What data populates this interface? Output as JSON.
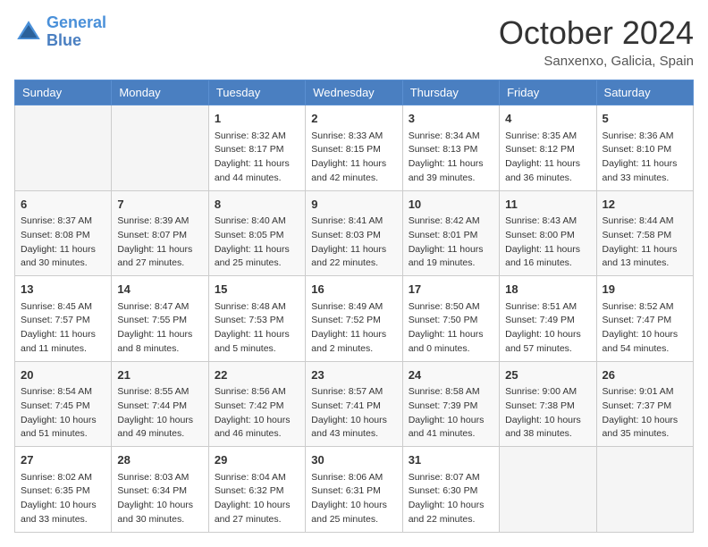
{
  "logo": {
    "line1": "General",
    "line2": "Blue"
  },
  "title": "October 2024",
  "location": "Sanxenxo, Galicia, Spain",
  "days_of_week": [
    "Sunday",
    "Monday",
    "Tuesday",
    "Wednesday",
    "Thursday",
    "Friday",
    "Saturday"
  ],
  "weeks": [
    [
      {
        "day": "",
        "content": ""
      },
      {
        "day": "",
        "content": ""
      },
      {
        "day": "1",
        "content": "Sunrise: 8:32 AM\nSunset: 8:17 PM\nDaylight: 11 hours and 44 minutes."
      },
      {
        "day": "2",
        "content": "Sunrise: 8:33 AM\nSunset: 8:15 PM\nDaylight: 11 hours and 42 minutes."
      },
      {
        "day": "3",
        "content": "Sunrise: 8:34 AM\nSunset: 8:13 PM\nDaylight: 11 hours and 39 minutes."
      },
      {
        "day": "4",
        "content": "Sunrise: 8:35 AM\nSunset: 8:12 PM\nDaylight: 11 hours and 36 minutes."
      },
      {
        "day": "5",
        "content": "Sunrise: 8:36 AM\nSunset: 8:10 PM\nDaylight: 11 hours and 33 minutes."
      }
    ],
    [
      {
        "day": "6",
        "content": "Sunrise: 8:37 AM\nSunset: 8:08 PM\nDaylight: 11 hours and 30 minutes."
      },
      {
        "day": "7",
        "content": "Sunrise: 8:39 AM\nSunset: 8:07 PM\nDaylight: 11 hours and 27 minutes."
      },
      {
        "day": "8",
        "content": "Sunrise: 8:40 AM\nSunset: 8:05 PM\nDaylight: 11 hours and 25 minutes."
      },
      {
        "day": "9",
        "content": "Sunrise: 8:41 AM\nSunset: 8:03 PM\nDaylight: 11 hours and 22 minutes."
      },
      {
        "day": "10",
        "content": "Sunrise: 8:42 AM\nSunset: 8:01 PM\nDaylight: 11 hours and 19 minutes."
      },
      {
        "day": "11",
        "content": "Sunrise: 8:43 AM\nSunset: 8:00 PM\nDaylight: 11 hours and 16 minutes."
      },
      {
        "day": "12",
        "content": "Sunrise: 8:44 AM\nSunset: 7:58 PM\nDaylight: 11 hours and 13 minutes."
      }
    ],
    [
      {
        "day": "13",
        "content": "Sunrise: 8:45 AM\nSunset: 7:57 PM\nDaylight: 11 hours and 11 minutes."
      },
      {
        "day": "14",
        "content": "Sunrise: 8:47 AM\nSunset: 7:55 PM\nDaylight: 11 hours and 8 minutes."
      },
      {
        "day": "15",
        "content": "Sunrise: 8:48 AM\nSunset: 7:53 PM\nDaylight: 11 hours and 5 minutes."
      },
      {
        "day": "16",
        "content": "Sunrise: 8:49 AM\nSunset: 7:52 PM\nDaylight: 11 hours and 2 minutes."
      },
      {
        "day": "17",
        "content": "Sunrise: 8:50 AM\nSunset: 7:50 PM\nDaylight: 11 hours and 0 minutes."
      },
      {
        "day": "18",
        "content": "Sunrise: 8:51 AM\nSunset: 7:49 PM\nDaylight: 10 hours and 57 minutes."
      },
      {
        "day": "19",
        "content": "Sunrise: 8:52 AM\nSunset: 7:47 PM\nDaylight: 10 hours and 54 minutes."
      }
    ],
    [
      {
        "day": "20",
        "content": "Sunrise: 8:54 AM\nSunset: 7:45 PM\nDaylight: 10 hours and 51 minutes."
      },
      {
        "day": "21",
        "content": "Sunrise: 8:55 AM\nSunset: 7:44 PM\nDaylight: 10 hours and 49 minutes."
      },
      {
        "day": "22",
        "content": "Sunrise: 8:56 AM\nSunset: 7:42 PM\nDaylight: 10 hours and 46 minutes."
      },
      {
        "day": "23",
        "content": "Sunrise: 8:57 AM\nSunset: 7:41 PM\nDaylight: 10 hours and 43 minutes."
      },
      {
        "day": "24",
        "content": "Sunrise: 8:58 AM\nSunset: 7:39 PM\nDaylight: 10 hours and 41 minutes."
      },
      {
        "day": "25",
        "content": "Sunrise: 9:00 AM\nSunset: 7:38 PM\nDaylight: 10 hours and 38 minutes."
      },
      {
        "day": "26",
        "content": "Sunrise: 9:01 AM\nSunset: 7:37 PM\nDaylight: 10 hours and 35 minutes."
      }
    ],
    [
      {
        "day": "27",
        "content": "Sunrise: 8:02 AM\nSunset: 6:35 PM\nDaylight: 10 hours and 33 minutes."
      },
      {
        "day": "28",
        "content": "Sunrise: 8:03 AM\nSunset: 6:34 PM\nDaylight: 10 hours and 30 minutes."
      },
      {
        "day": "29",
        "content": "Sunrise: 8:04 AM\nSunset: 6:32 PM\nDaylight: 10 hours and 27 minutes."
      },
      {
        "day": "30",
        "content": "Sunrise: 8:06 AM\nSunset: 6:31 PM\nDaylight: 10 hours and 25 minutes."
      },
      {
        "day": "31",
        "content": "Sunrise: 8:07 AM\nSunset: 6:30 PM\nDaylight: 10 hours and 22 minutes."
      },
      {
        "day": "",
        "content": ""
      },
      {
        "day": "",
        "content": ""
      }
    ]
  ]
}
